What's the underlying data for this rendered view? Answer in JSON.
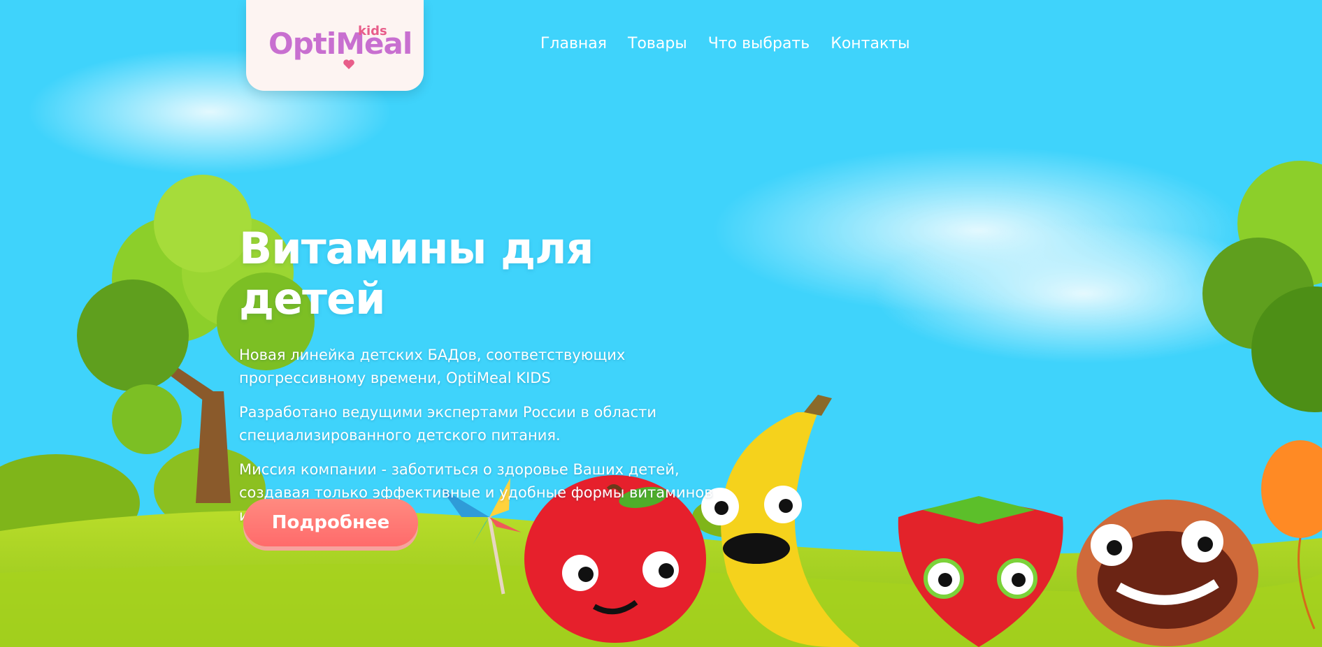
{
  "brand": {
    "logo_main": "OptiMeal",
    "logo_kids": "kids"
  },
  "nav": {
    "items": [
      {
        "label": "Главная"
      },
      {
        "label": "Товары"
      },
      {
        "label": "Что выбрать"
      },
      {
        "label": "Контакты"
      }
    ]
  },
  "hero": {
    "title": "Витамины для детей",
    "paragraphs": [
      "Новая линейка детских БАДов, соответствующих прогрессивному времени, OptiMeal KIDS",
      "Разработано ведущими экспертами России в области специализированного детского питания.",
      "Миссия компании - заботиться о здоровье Ваших детей, создавая только эффективные и удобные формы витаминов и пищевых добавок."
    ],
    "cta_label": "Подробнее"
  },
  "colors": {
    "sky": "#3fd3fb",
    "grass": "#9ccc1c",
    "logo_purple": "#c86fd0",
    "logo_pink": "#e85d8a",
    "cta": "#ff6b6b"
  },
  "icons": [
    "heart-icon",
    "pinwheel-icon",
    "balloon-icon"
  ]
}
